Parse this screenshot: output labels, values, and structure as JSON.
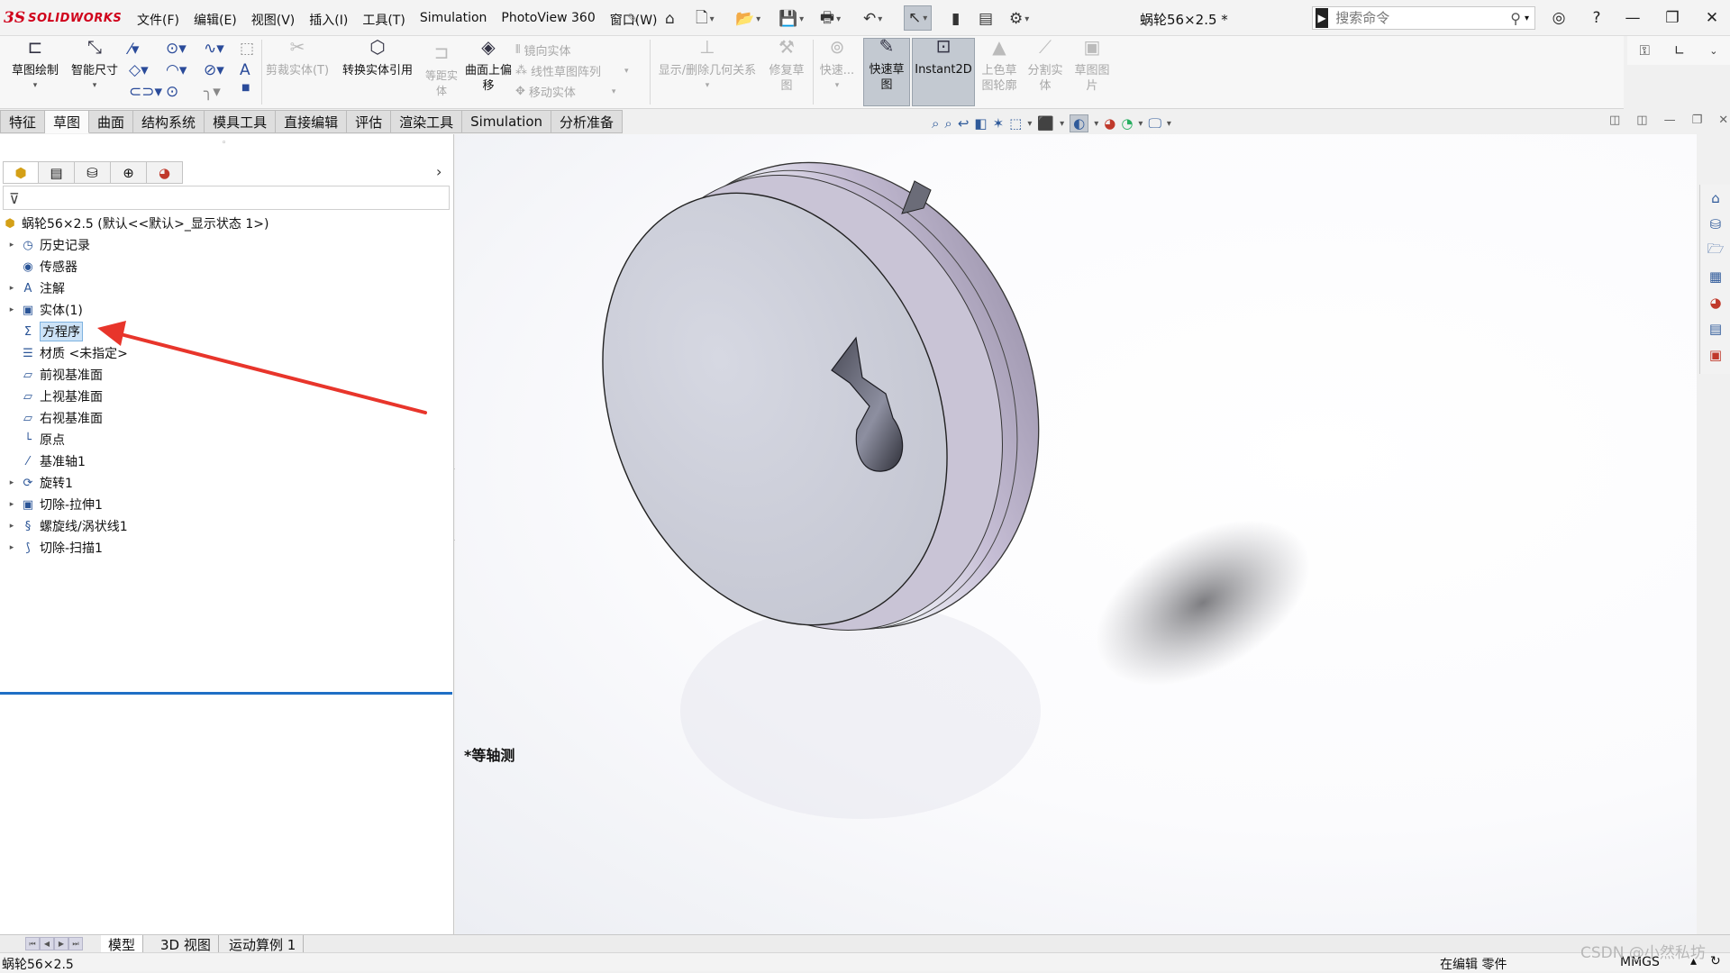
{
  "app": {
    "logo_prefix": "3S",
    "logo_text": "SOLIDWORKS",
    "menus": [
      "文件(F)",
      "编辑(E)",
      "视图(V)",
      "插入(I)",
      "工具(T)",
      "Simulation",
      "PhotoView 360",
      "窗口(W)"
    ],
    "document_title": "蜗轮56×2.5 *"
  },
  "search": {
    "placeholder": "搜索命令"
  },
  "ribbon": {
    "sketch": "草图绘制",
    "smart_dim": "智能尺寸",
    "trim": "剪裁实体(T)",
    "convert": "转换实体引用",
    "offset": "等距实体",
    "offset_on_surface": "曲面上偏移",
    "mirror": "镜向实体",
    "linear_pattern": "线性草图阵列",
    "move": "移动实体",
    "relations": "显示/删除几何关系",
    "repair": "修复草图",
    "quick_snaps": "快速...",
    "rapid_sketch": "快速草图",
    "instant2d": "Instant2D",
    "shaded_contours": "上色草图轮廓",
    "split_entities": "分割实体",
    "sketch_picture": "草图图片"
  },
  "tabs": [
    "特征",
    "草图",
    "曲面",
    "结构系统",
    "模具工具",
    "直接编辑",
    "评估",
    "渲染工具",
    "Simulation",
    "分析准备"
  ],
  "active_tab": "草图",
  "tree": {
    "root": "蜗轮56×2.5 (默认<<默认>_显示状态 1>)",
    "items": [
      {
        "label": "历史记录",
        "icon": "history-icon",
        "expandable": true
      },
      {
        "label": "传感器",
        "icon": "sensor-icon",
        "expandable": false
      },
      {
        "label": "注解",
        "icon": "annotation-icon",
        "expandable": true
      },
      {
        "label": "实体(1)",
        "icon": "solid-body-icon",
        "expandable": true
      },
      {
        "label": "方程序",
        "icon": "equation-icon",
        "expandable": false,
        "selected": true
      },
      {
        "label": "材质 <未指定>",
        "icon": "material-icon",
        "expandable": false
      },
      {
        "label": "前视基准面",
        "icon": "plane-icon",
        "expandable": false
      },
      {
        "label": "上视基准面",
        "icon": "plane-icon",
        "expandable": false
      },
      {
        "label": "右视基准面",
        "icon": "plane-icon",
        "expandable": false
      },
      {
        "label": "原点",
        "icon": "origin-icon",
        "expandable": false
      },
      {
        "label": "基准轴1",
        "icon": "axis-icon",
        "expandable": false
      },
      {
        "label": "旋转1",
        "icon": "revolve-icon",
        "expandable": true
      },
      {
        "label": "切除-拉伸1",
        "icon": "cut-extrude-icon",
        "expandable": true
      },
      {
        "label": "螺旋线/涡状线1",
        "icon": "helix-icon",
        "expandable": true
      },
      {
        "label": "切除-扫描1",
        "icon": "cut-sweep-icon",
        "expandable": true
      }
    ]
  },
  "viewport": {
    "orientation": "*等轴测"
  },
  "bottom_tabs": [
    "模型",
    "3D 视图",
    "运动算例 1"
  ],
  "status": {
    "left": "蜗轮56×2.5",
    "editing": "在编辑 零件",
    "units": "MMGS",
    "watermark": "CSDN @小然私坊"
  },
  "colors": {
    "annotation_arrow": "#e8352b",
    "selection_bg": "#cde3f7",
    "tree_endline": "#1f6fc5",
    "brand_red": "#d0021b"
  }
}
